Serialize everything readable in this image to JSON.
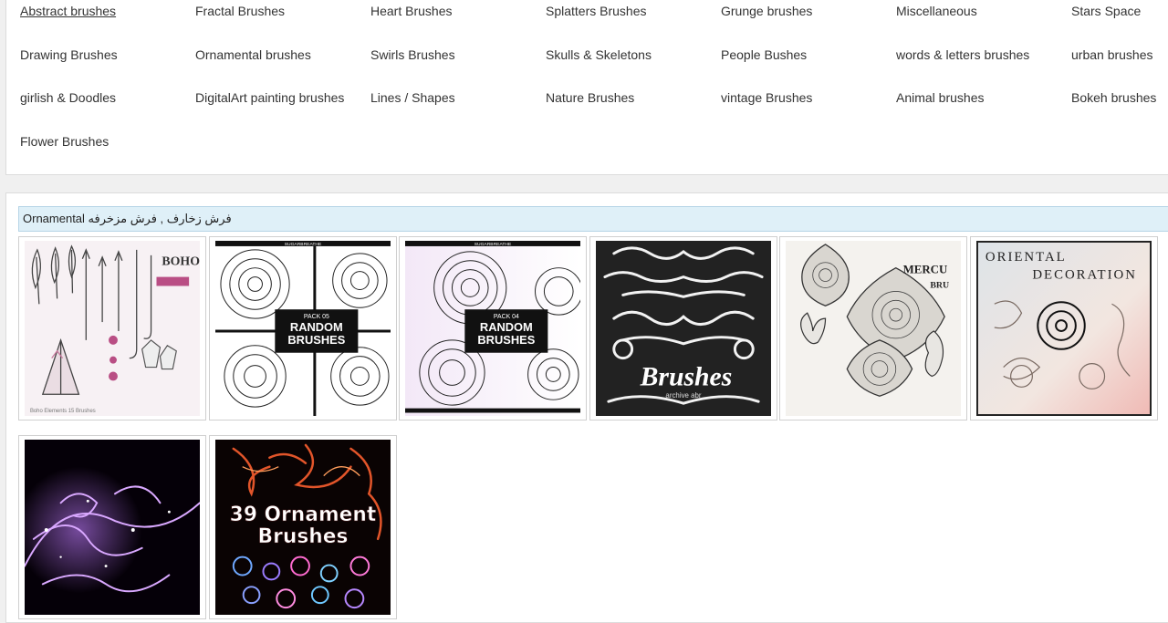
{
  "categories": [
    {
      "label": "Abstract brushes",
      "active": true
    },
    {
      "label": "Fractal Brushes"
    },
    {
      "label": "Heart Brushes"
    },
    {
      "label": "Splatters Brushes"
    },
    {
      "label": "Grunge brushes"
    },
    {
      "label": "Miscellaneous"
    },
    {
      "label": "Stars Space"
    },
    {
      "label": "Drawing Brushes"
    },
    {
      "label": "Ornamental brushes"
    },
    {
      "label": "Swirls Brushes"
    },
    {
      "label": "Skulls & Skeletons"
    },
    {
      "label": "People Bushes"
    },
    {
      "label": "words & letters brushes"
    },
    {
      "label": "urban brushes"
    },
    {
      "label": "girlish & Doodles"
    },
    {
      "label": "DigitalArt painting brushes"
    },
    {
      "label": "Lines / Shapes"
    },
    {
      "label": "Nature Brushes"
    },
    {
      "label": "vintage Brushes"
    },
    {
      "label": "Animal brushes"
    },
    {
      "label": "Bokeh brushes"
    },
    {
      "label": "Flower Brushes"
    }
  ],
  "section": {
    "title": "Ornamental فرش زخارف , فرش مزخرفه"
  },
  "thumbnails": [
    {
      "name": "boho-elements",
      "text": [
        "BOHO",
        "Boho Elements 15 Brushes"
      ]
    },
    {
      "name": "random-brushes-pack-05",
      "text": [
        "PACK 05",
        "RANDOM",
        "BRUSHES",
        "SUGARBREATHE"
      ]
    },
    {
      "name": "random-brushes-pack-04",
      "text": [
        "PACK 04",
        "RANDOM",
        "BRUSHES",
        "SUGARBREATHE"
      ]
    },
    {
      "name": "vintage-ornament-brushes",
      "text": [
        "Brushes",
        "archive abr"
      ]
    },
    {
      "name": "mercury-brushes",
      "text": [
        "MERCU",
        "BRU"
      ]
    },
    {
      "name": "oriental-decoration",
      "text": [
        "ORIENTAL",
        "DECORATION"
      ]
    },
    {
      "name": "purple-swirls",
      "text": []
    },
    {
      "name": "39-ornament-brushes",
      "text": [
        "39 Ornament",
        "Brushes"
      ]
    }
  ]
}
